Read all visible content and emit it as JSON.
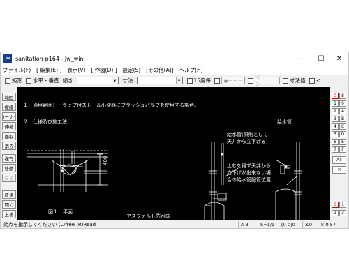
{
  "window": {
    "title": "sanitation-p164 - jw_win",
    "app_icon_text": "jw",
    "controls": [
      "—",
      "☐",
      "✕"
    ]
  },
  "menu": [
    "ファイル(F)",
    "[ 編集(E) ]",
    "表示(V)",
    "[ 作図(D) ]",
    "設定(S)",
    "[その他(A)]",
    "ヘルプ(H)"
  ],
  "toolbar": {
    "rect_label": "矩形",
    "hv_label": "水平・垂直",
    "slope_label": "傾き",
    "dim_label": "寸法",
    "deg15_label": "15度毎",
    "btn1_label": "●－－－",
    "btn2_label": "＜－－－＞",
    "dimval_label": "寸法値",
    "last_label": "＜"
  },
  "left_buttons": [
    "範囲",
    "複線",
    "コーナー",
    "伸縮",
    "面取",
    "消去",
    "複写",
    "移動",
    "戻る",
    "新規",
    "開く",
    "上書"
  ],
  "canvas": {
    "line1": "１．適用範囲：トラップ付ストール小便器にフラッシュバルブを使用する場合。",
    "line2": "２．仕様及び施工法",
    "fig_label": "図１　平面",
    "dim_400": "400",
    "asphalt": "アスファルト防水床",
    "note1a": "給水管(原則として",
    "note1b": "天井から立下げる)",
    "note2a": "止むを得ず天井から",
    "note2b": "立下げが出来ない場",
    "note2c": "合の給水管配管位置",
    "pipe_label": "給水管"
  },
  "right_buttons": {
    "col1": [
      "0",
      "1",
      "2",
      "3",
      "4",
      "5",
      "6",
      "7"
    ],
    "col2": [
      "8",
      "9",
      "A",
      "B",
      "C",
      "D",
      "E",
      "F"
    ],
    "all_label": "All",
    "x_label": "✕",
    "bottom1": [
      "0",
      "1"
    ],
    "bottom2": [
      "2",
      "3"
    ]
  },
  "status": {
    "message": "始点を指示してください (L)free (R)Read",
    "paper": "A-3",
    "scale": "S=1/1",
    "layer": "[0-0]0",
    "angle": "∠0",
    "zoom": "× 0.57"
  }
}
